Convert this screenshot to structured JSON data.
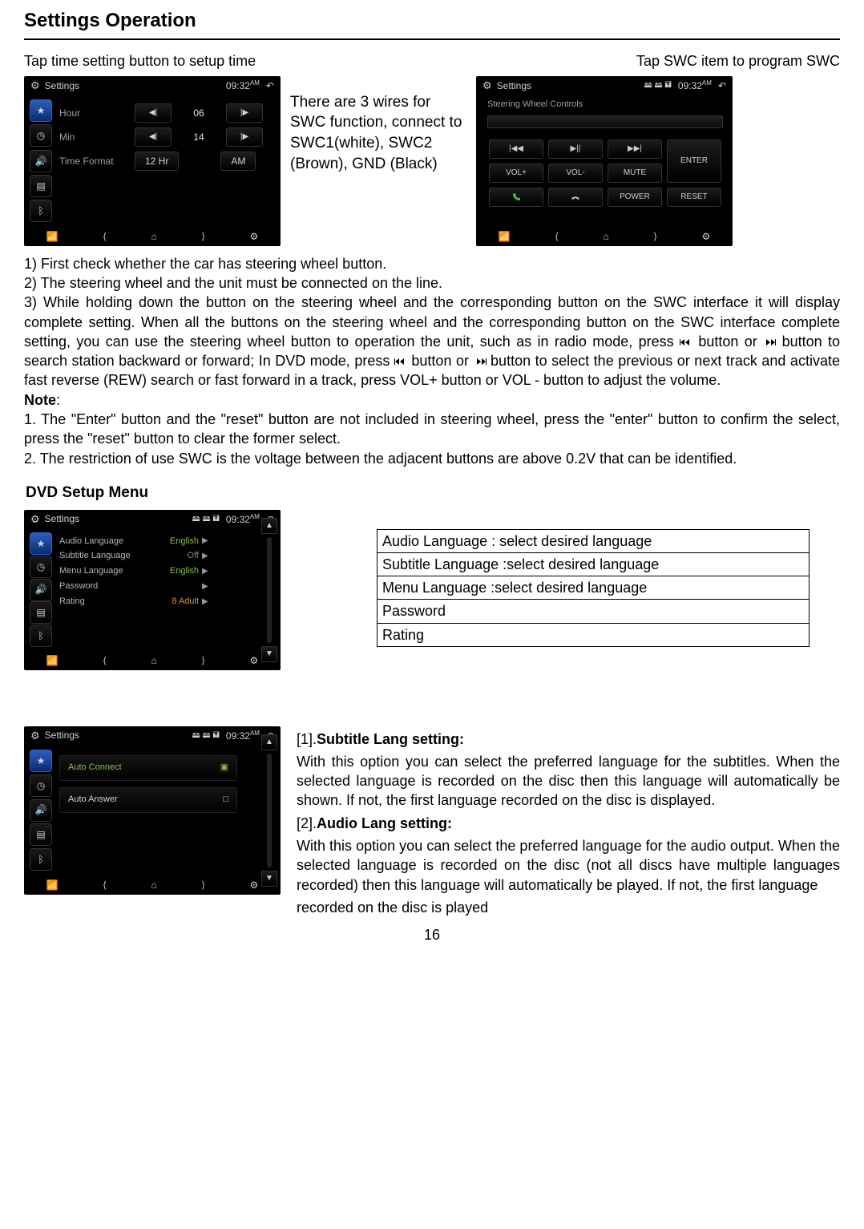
{
  "title": "Settings Operation",
  "header": {
    "left": "Tap time setting button to setup time",
    "right": "Tap SWC item to program SWC"
  },
  "middle_note": "There are 3 wires for SWC function, connect to SWC1(white), SWC2 (Brown), GND (Black)",
  "screen_common": {
    "settings_label": "Settings",
    "time_label": "09:32",
    "time_ampm": "AM",
    "swc_title": "Steering Wheel Controls"
  },
  "time_screen": {
    "rows": {
      "hour": {
        "label": "Hour",
        "value": "06"
      },
      "min": {
        "label": "Min",
        "value": "14"
      },
      "format": {
        "label": "Time Format",
        "value": "12 Hr",
        "ampm": "AM"
      }
    }
  },
  "swc_keys": [
    "|◀◀",
    "▶||",
    "▶▶|",
    "ENTER",
    "VOL+",
    "VOL-",
    "MUTE",
    "",
    "📞",
    "⏹",
    "POWER",
    "RESET"
  ],
  "swc_phone_call": "📞",
  "swc_hangup": "⏹",
  "swc_text": {
    "p1": "1) First check whether the car has steering wheel button.",
    "p2": "2) The steering wheel and the unit must be connected on the line.",
    "p3a": "3) While holding down the button on the steering wheel and the corresponding button on the SWC interface it will display complete setting. When all the buttons on the steering wheel and the corresponding button on the SWC interface complete setting, you can use the steering wheel button to operation the unit, such as in radio mode, press",
    "p3b": "button or",
    "p3c": "button to search station backward or forward; In DVD mode, press",
    "p3d": "button or",
    "p3e": "button to select the previous or next track and activate fast reverse (REW) search or fast forward in a track, press VOL+ button or VOL - button to adjust the volume.",
    "note_label": "Note",
    "note_colon": ":",
    "n1": "1. The \"Enter\" button and the \"reset\" button are not included in steering wheel, press the \"enter\" button to confirm the select, press the \"reset\" button to clear the former select.",
    "n2": "2. The restriction of use SWC is the voltage between the adjacent buttons are above 0.2V that can be identified."
  },
  "dvd_header": "DVD Setup Menu",
  "dvd_screen": {
    "rows": [
      {
        "label": "Audio Language",
        "value": "English",
        "cls": "green"
      },
      {
        "label": "Subtitle Language",
        "value": "Off",
        "cls": ""
      },
      {
        "label": "Menu Language",
        "value": "English",
        "cls": "green"
      },
      {
        "label": "Password",
        "value": "",
        "cls": ""
      },
      {
        "label": "Rating",
        "value": "8 Adult",
        "cls": "orange"
      }
    ]
  },
  "lang_table": {
    "r1": "Audio Language   : select desired language",
    "r2": "Subtitle Language :select desired language",
    "r3": "Menu Language   :select desired language",
    "r4": "Password",
    "r5": "Rating"
  },
  "bt_screen": {
    "rows": [
      {
        "label": "Auto Connect",
        "cls": "green"
      },
      {
        "label": "Auto Answer",
        "cls": ""
      }
    ]
  },
  "bt_text": {
    "h1_pre": "[1].",
    "h1": "Subtitle Lang setting:",
    "p1": "With this option you can select the preferred language for the subtitles. When the selected language is recorded on the disc then this language will automatically be shown. If not, the first language recorded on the disc is displayed.",
    "h2_pre": "[2].",
    "h2": "Audio Lang setting:",
    "p2": "With this option you can select the preferred language for the audio output. When the selected language is recorded on the disc (not all discs have multiple languages recorded) then this language will automatically be played. If not, the first language",
    "p3": "recorded on the disc is played"
  },
  "page_number": "16"
}
